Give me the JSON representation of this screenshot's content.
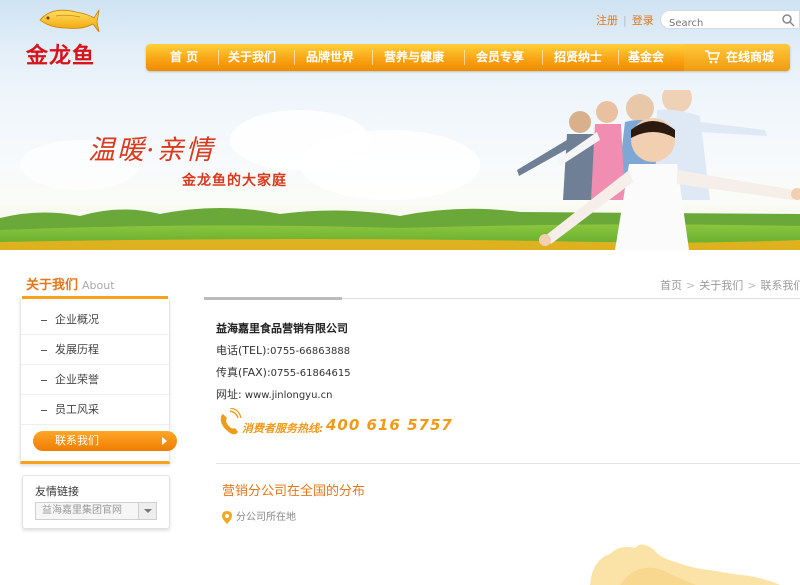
{
  "header": {
    "brand_name": "金龙鱼",
    "top_links": [
      "注册",
      "登录"
    ],
    "search": {
      "placeholder": "Search"
    },
    "nav": [
      "首 页",
      "关于我们",
      "品牌世界",
      "营养与健康",
      "会员专享",
      "招贤纳士",
      "基金会"
    ],
    "cart_label": "在线商城"
  },
  "banner": {
    "slogan_main": "温暖·亲情",
    "slogan_sub": "金龙鱼的大家庭"
  },
  "sidebar": {
    "title_cn": "关于我们",
    "title_en": "About",
    "items": [
      {
        "label": "企业概况"
      },
      {
        "label": "发展历程"
      },
      {
        "label": "企业荣誉"
      },
      {
        "label": "员工风采"
      },
      {
        "label": "联系我们"
      }
    ],
    "friend_links": {
      "label": "友情链接",
      "selected": "益海嘉里集团官网"
    }
  },
  "breadcrumb": [
    "首页",
    "关于我们",
    "联系我们"
  ],
  "contact": {
    "company": "益海嘉里食品营销有限公司",
    "tel_label": "电话(TEL):",
    "tel": "0755-66863888",
    "fax_label": "传真(FAX):",
    "fax": "0755-61864615",
    "url_label": "网址:",
    "url": "www.jinlongyu.cn",
    "hotline_label": "消费者服务热线:",
    "hotline": "400 616 5757"
  },
  "branch": {
    "title": "营销分公司在全国的分布",
    "legend": "分公司所在地"
  },
  "colors": {
    "accent_orange": "#f7a11c",
    "brand_red": "#d7141b",
    "title_orange": "#e4771a"
  }
}
